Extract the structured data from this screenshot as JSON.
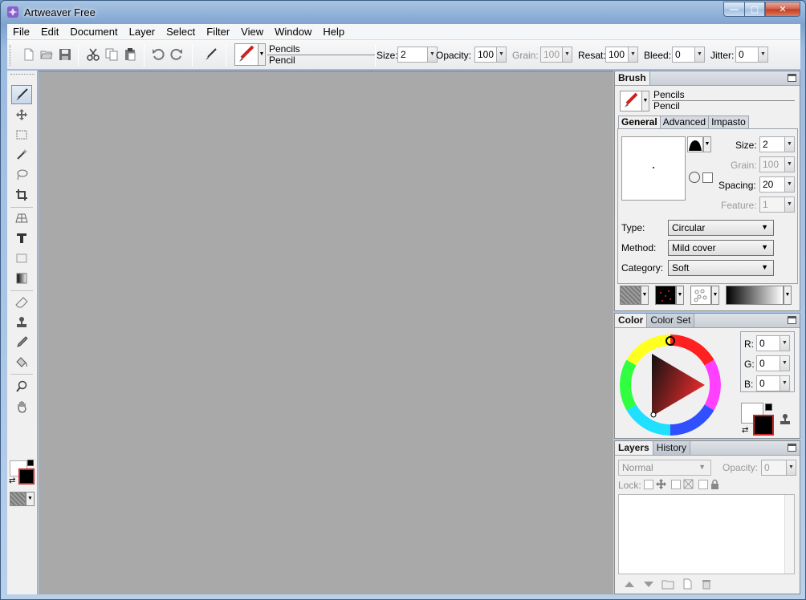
{
  "window": {
    "title": "Artweaver Free",
    "min_glyph": "—",
    "max_glyph": "▢",
    "close_glyph": "✕"
  },
  "menu": [
    "File",
    "Edit",
    "Document",
    "Layer",
    "Select",
    "Filter",
    "View",
    "Window",
    "Help"
  ],
  "toolbar": {
    "preset_category": "Pencils",
    "preset_name": "Pencil",
    "size_label": "Size:",
    "size_value": "2",
    "opacity_label": "Opacity:",
    "opacity_value": "100",
    "grain_label": "Grain:",
    "grain_value": "100",
    "resat_label": "Resat:",
    "resat_value": "100",
    "bleed_label": "Bleed:",
    "bleed_value": "0",
    "jitter_label": "Jitter:",
    "jitter_value": "0"
  },
  "brush_panel": {
    "title": "Brush",
    "category": "Pencils",
    "name": "Pencil",
    "tabs": [
      "General",
      "Advanced",
      "Impasto"
    ],
    "size_label": "Size:",
    "size_value": "2",
    "grain_label": "Grain:",
    "grain_value": "100",
    "spacing_label": "Spacing:",
    "spacing_value": "20",
    "feature_label": "Feature:",
    "feature_value": "1",
    "type_label": "Type:",
    "type_value": "Circular",
    "method_label": "Method:",
    "method_value": "Mild cover",
    "category_label": "Category:",
    "category_value": "Soft"
  },
  "color_panel": {
    "tabs": [
      "Color",
      "Color Set"
    ],
    "r_label": "R:",
    "r_value": "0",
    "g_label": "G:",
    "g_value": "0",
    "b_label": "B:",
    "b_value": "0",
    "foreground_color": "#000000",
    "background_color": "#ffffff"
  },
  "layers_panel": {
    "tabs": [
      "Layers",
      "History"
    ],
    "blend_mode": "Normal",
    "opacity_label": "Opacity:",
    "opacity_value": "0",
    "lock_label": "Lock:"
  },
  "icons": {
    "dropdown_glyph": "▼",
    "swap_glyph": "⇄"
  },
  "colors": {
    "canvas_bg": "#a9a9a9",
    "panel_bg": "#f0f0f0",
    "active_fg_border": "#c8282a"
  }
}
